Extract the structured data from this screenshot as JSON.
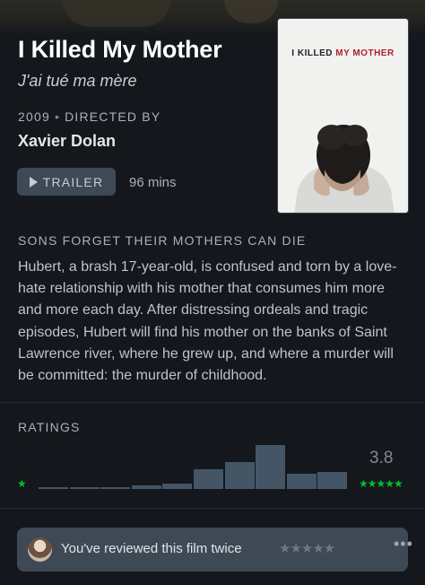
{
  "film": {
    "title": "I Killed My Mother",
    "original_title": "J'ai tué ma mère",
    "year": "2009",
    "directed_by_label": "DIRECTED BY",
    "director": "Xavier Dolan",
    "trailer_label": "TRAILER",
    "runtime": "96 mins"
  },
  "poster": {
    "title_part1": "I KILLED ",
    "title_part2": "MY MOTHER"
  },
  "tagline": "SONS FORGET THEIR MOTHERS CAN DIE",
  "synopsis": "Hubert, a brash 17-year-old, is confused and torn by a love-hate relationship with his mother that consumes him more and more each day. After distressing ordeals and tragic episodes, Hubert will find his mother on the banks of Saint Lawrence river, where he grew up, and where a murder will be committed: the murder of childhood.",
  "ratings": {
    "label": "RATINGS",
    "average": "3.8",
    "low_star": "★",
    "high_stars": "★★★★★",
    "histogram": [
      0.04,
      0.04,
      0.04,
      0.08,
      0.12,
      0.42,
      0.58,
      0.94,
      0.33,
      0.37
    ],
    "bar_color": "#445566",
    "star_color": "#00c030"
  },
  "review": {
    "text": "You've reviewed this film twice",
    "stars": "★★★★★",
    "more_icon": "•••"
  },
  "colors": {
    "background": "#14181c",
    "button": "#3e4955"
  }
}
